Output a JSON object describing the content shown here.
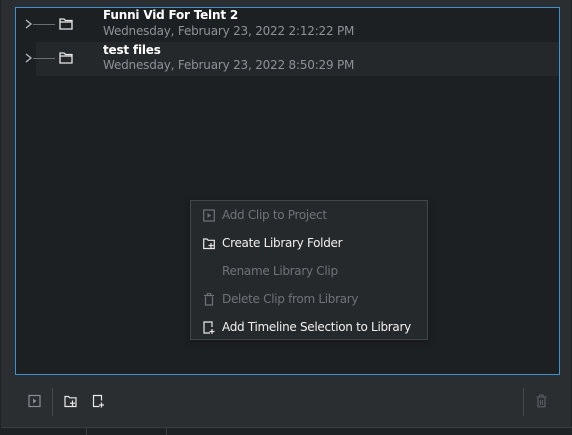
{
  "library": {
    "items": [
      {
        "title": "Funni Vid For Telnt 2",
        "date": "Wednesday, February 23, 2022 2:12:22 PM"
      },
      {
        "title": "test files",
        "date": "Wednesday, February 23, 2022 8:50:29 PM"
      }
    ]
  },
  "context_menu": {
    "items": [
      {
        "label": "Add Clip to Project",
        "enabled": false,
        "icon": "add-clip-icon"
      },
      {
        "label": "Create Library Folder",
        "enabled": true,
        "icon": "new-folder-icon"
      },
      {
        "label": "Rename Library Clip",
        "enabled": false,
        "icon": ""
      },
      {
        "label": "Delete Clip from Library",
        "enabled": false,
        "icon": "trash-icon"
      },
      {
        "label": "Add Timeline Selection to Library",
        "enabled": true,
        "icon": "add-selection-icon"
      }
    ]
  },
  "toolbar": {
    "buttons": [
      "add-clip-icon",
      "new-folder-icon",
      "add-selection-icon",
      "trash-icon"
    ]
  },
  "colors": {
    "selection_border": "#3e91cf",
    "panel_bg": "#2b2e31",
    "tree_bg": "#1d2023",
    "menu_bg": "#26292c",
    "disabled_text": "#6f7377"
  }
}
